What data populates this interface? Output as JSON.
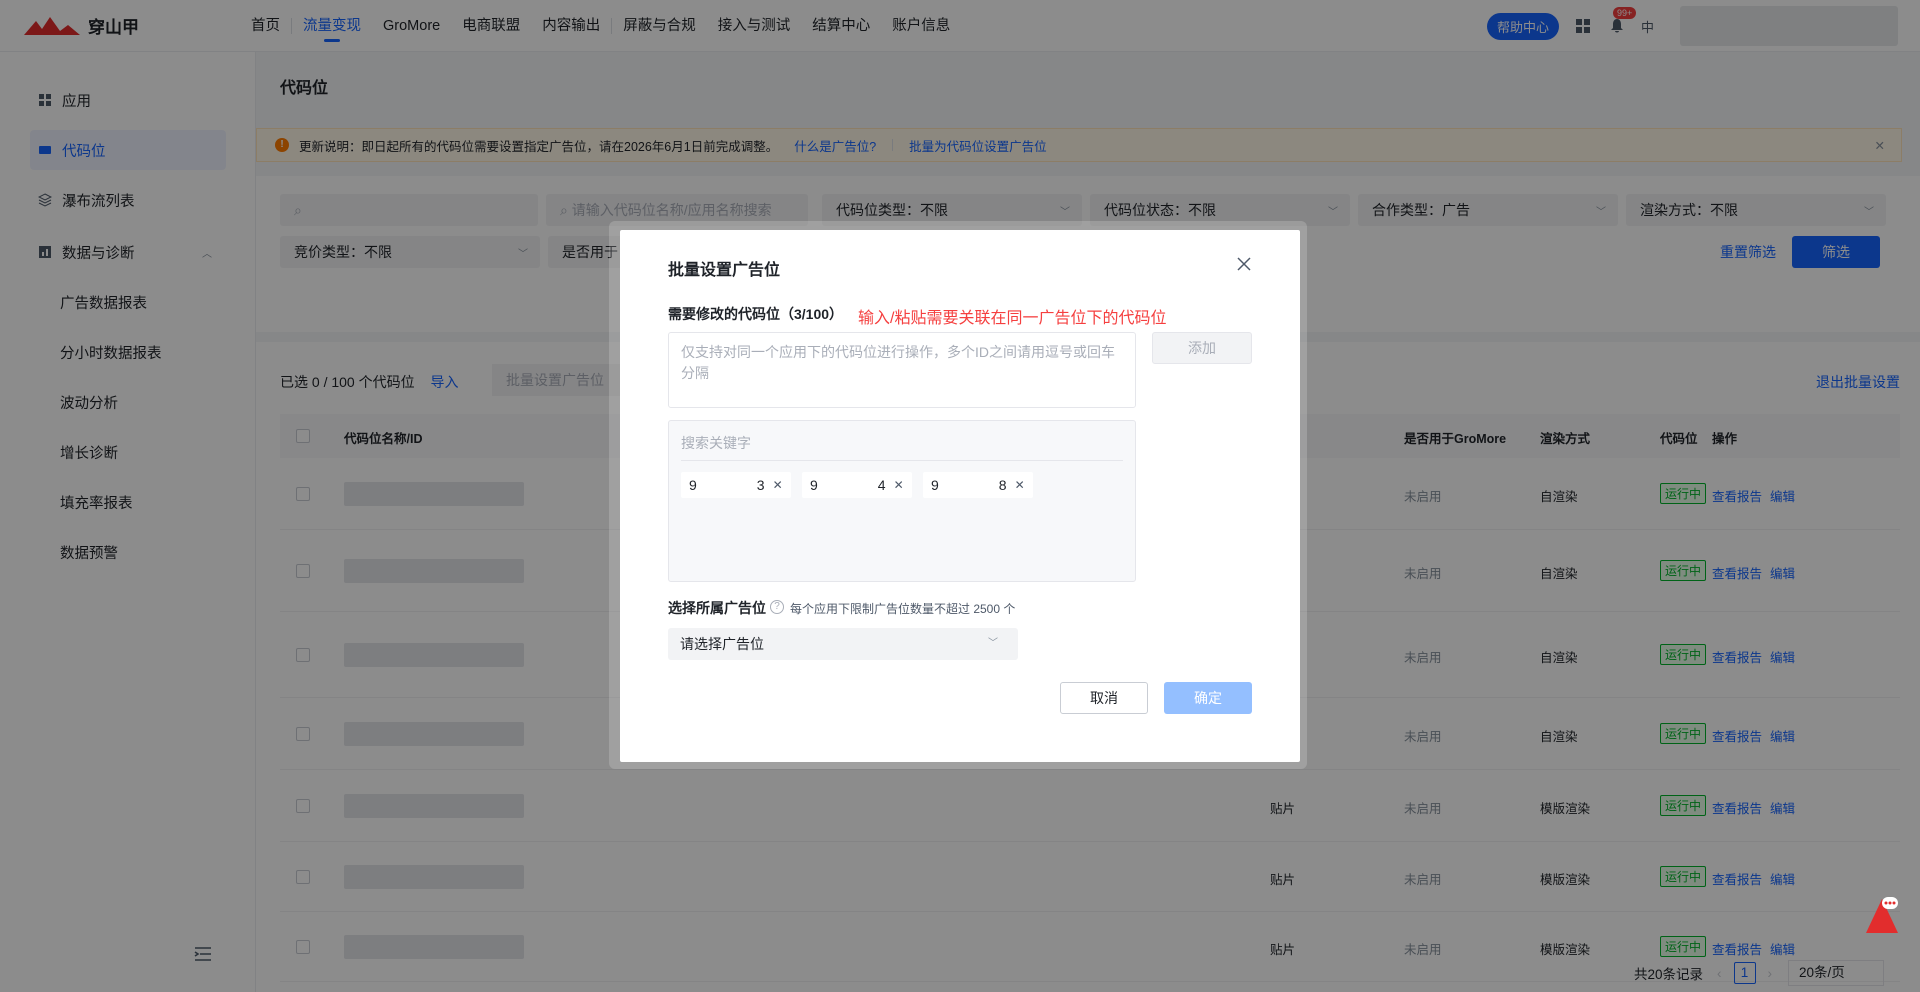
{
  "brand": {
    "name": "穿山甲"
  },
  "nav": {
    "items": [
      "首页",
      "流量变现",
      "GroMore",
      "电商联盟",
      "内容输出",
      "屏蔽与合规",
      "接入与测试",
      "结算中心",
      "账户信息"
    ],
    "active_index": 1
  },
  "topbar": {
    "help": "帮助中心",
    "notify_badge": "99+",
    "lang": "中"
  },
  "sidebar": {
    "items": [
      {
        "label": "应用",
        "icon": "grid-icon"
      },
      {
        "label": "代码位",
        "icon": "ad-slot-icon"
      },
      {
        "label": "瀑布流列表",
        "icon": "layers-icon"
      },
      {
        "label": "数据与诊断",
        "icon": "chart-icon"
      }
    ],
    "sub_items": [
      "广告数据报表",
      "分小时数据报表",
      "波动分析",
      "增长诊断",
      "填充率报表",
      "数据预警"
    ]
  },
  "page": {
    "title": "代码位"
  },
  "notice": {
    "text": "更新说明：即日起所有的代码位需要设置指定广告位，请在2026年6月1日前完成调整。",
    "link1": "什么是广告位?",
    "link2": "批量为代码位设置广告位"
  },
  "filters": {
    "search_app_placeholder": "",
    "search_slot_placeholder": "请输入代码位名称/应用名称搜索",
    "slot_type": "代码位类型：不限",
    "slot_status": "代码位状态：不限",
    "coop_type": "合作类型：广告",
    "render_type": "渲染方式：不限",
    "bid_type": "竞价类型：不限",
    "gromore_prefix": "是否用于",
    "reset": "重置筛选",
    "filter": "筛选"
  },
  "table": {
    "selected_info": "已选 0 / 100 个代码位",
    "import": "导入",
    "batch_set": "批量设置广告位",
    "exit_batch": "退出批量设置",
    "headers": {
      "name": "代码位名称/ID",
      "gromore": "是否用于GroMore",
      "render": "渲染方式",
      "status": "代码位",
      "ops": "操作"
    },
    "rows": [
      {
        "type": "",
        "gromore": "未启用",
        "render": "自渲染",
        "status": "运行中"
      },
      {
        "type": "",
        "gromore": "未启用",
        "render": "自渲染",
        "status": "运行中"
      },
      {
        "type": "",
        "gromore": "未启用",
        "render": "自渲染",
        "status": "运行中"
      },
      {
        "type": "",
        "gromore": "未启用",
        "render": "自渲染",
        "status": "运行中"
      },
      {
        "type": "贴片",
        "gromore": "未启用",
        "render": "模版渲染",
        "status": "运行中"
      },
      {
        "type": "贴片",
        "gromore": "未启用",
        "render": "模版渲染",
        "status": "运行中"
      },
      {
        "type": "贴片",
        "gromore": "未启用",
        "render": "模版渲染",
        "status": "运行中"
      }
    ],
    "op_report": "查看报告",
    "op_edit": "编辑"
  },
  "pager": {
    "total": "共20条记录",
    "page": "1",
    "size": "20条/页"
  },
  "modal": {
    "title": "批量设置广告位",
    "slots_label": "需要修改的代码位（3/100）",
    "red_hint": "输入/粘贴需要关联在同一广告位下的代码位",
    "textarea_placeholder": "仅支持对同一个应用下的代码位进行操作，多个ID之间请用逗号或回车分隔",
    "add": "添加",
    "search_placeholder": "搜索关键字",
    "tags": [
      {
        "start": "9",
        "end": "3"
      },
      {
        "start": "9",
        "end": "4"
      },
      {
        "start": "9",
        "end": "8"
      }
    ],
    "select_label": "选择所属广告位",
    "select_hint": "每个应用下限制广告位数量不超过 2500 个",
    "select_placeholder": "请选择广告位",
    "cancel": "取消",
    "ok": "确定"
  },
  "colors": {
    "primary": "#1664ff",
    "danger": "#f53f3f",
    "disabled_primary": "#94bfff",
    "success": "#00b42a"
  }
}
